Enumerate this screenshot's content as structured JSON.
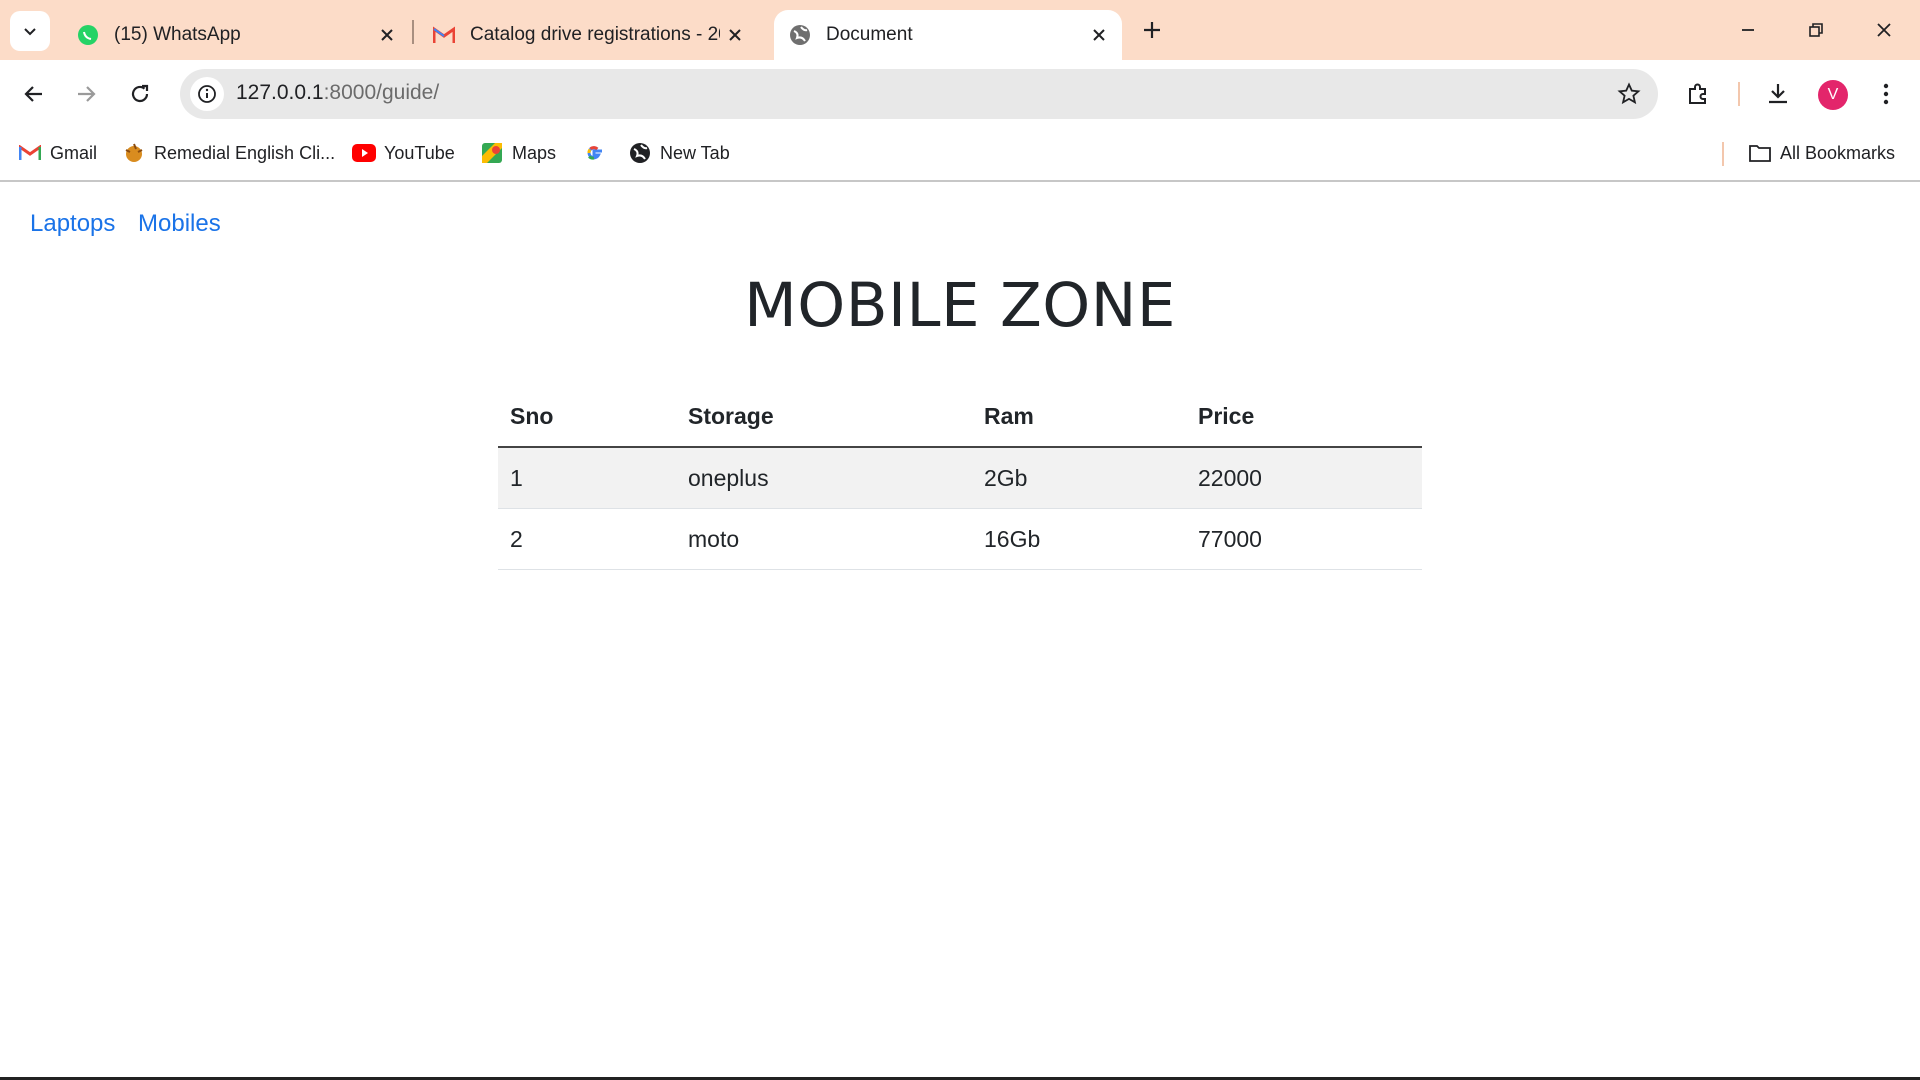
{
  "browser": {
    "tabs": [
      {
        "title": "(15) WhatsApp",
        "icon": "whatsapp-icon",
        "active": false
      },
      {
        "title": "Catalog drive registrations - 20",
        "icon": "gmail-icon",
        "active": false
      },
      {
        "title": "Document",
        "icon": "globe-icon",
        "active": true
      }
    ],
    "address": {
      "host": "127.0.0.1",
      "path": ":8000/guide/"
    },
    "profile_initial": "V",
    "bookmarks": [
      {
        "label": "Gmail",
        "icon": "gmail-icon"
      },
      {
        "label": "Remedial English Cli...",
        "icon": "remedial-english-icon"
      },
      {
        "label": "YouTube",
        "icon": "youtube-icon"
      },
      {
        "label": "Maps",
        "icon": "maps-icon"
      },
      {
        "label": "",
        "icon": "google-icon"
      },
      {
        "label": "New Tab",
        "icon": "globe-icon"
      }
    ],
    "all_bookmarks_label": "All Bookmarks"
  },
  "page": {
    "nav": [
      {
        "label": "Laptops"
      },
      {
        "label": "Mobiles"
      }
    ],
    "title": "MOBILE ZONE",
    "table": {
      "headers": [
        "Sno",
        "Storage",
        "Ram",
        "Price"
      ],
      "rows": [
        [
          "1",
          "oneplus",
          "2Gb",
          "22000"
        ],
        [
          "2",
          "moto",
          "16Gb",
          "77000"
        ]
      ]
    }
  },
  "colors": {
    "tabstrip": "#fcdcc8",
    "link": "#1a73e8",
    "avatar": "#e3256b",
    "row_stripe": "#f2f2f2"
  }
}
